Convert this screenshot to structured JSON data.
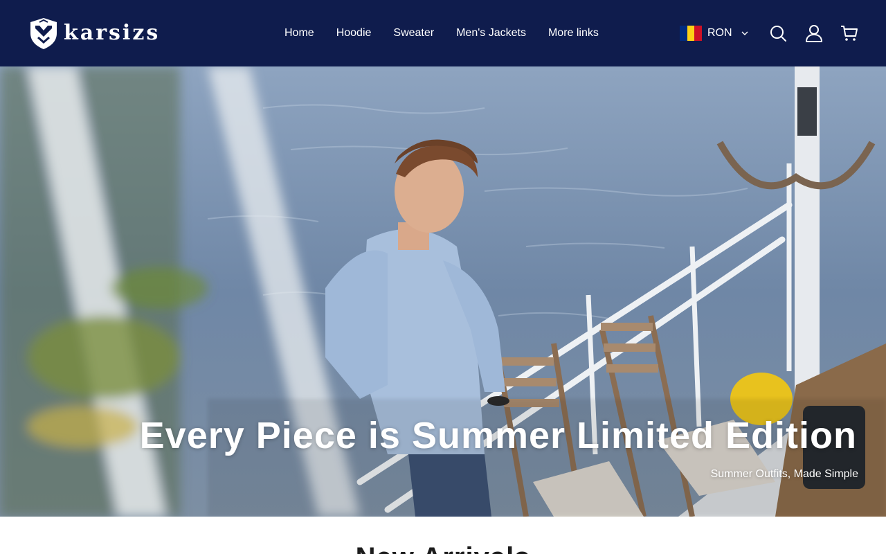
{
  "brand": {
    "name": "karsizs",
    "logo_icon": "shield-crest-icon"
  },
  "nav": {
    "items": [
      {
        "label": "Home"
      },
      {
        "label": "Hoodie"
      },
      {
        "label": "Sweater"
      },
      {
        "label": "Men's Jackets"
      },
      {
        "label": "More links"
      }
    ]
  },
  "currency": {
    "code": "RON",
    "flag_icon": "romania-flag-icon",
    "flag_colors": [
      "#002b7f",
      "#fcd116",
      "#ce1126"
    ]
  },
  "header_icons": {
    "search": "search-icon",
    "account": "user-icon",
    "cart": "cart-icon"
  },
  "hero": {
    "title": "Every Piece is Summer Limited Edition",
    "subtitle": "Summer Outfits, Made Simple"
  },
  "section": {
    "heading": "New Arrivals"
  },
  "colors": {
    "header_bg": "#0f1c4d",
    "text_on_dark": "#ffffff"
  }
}
